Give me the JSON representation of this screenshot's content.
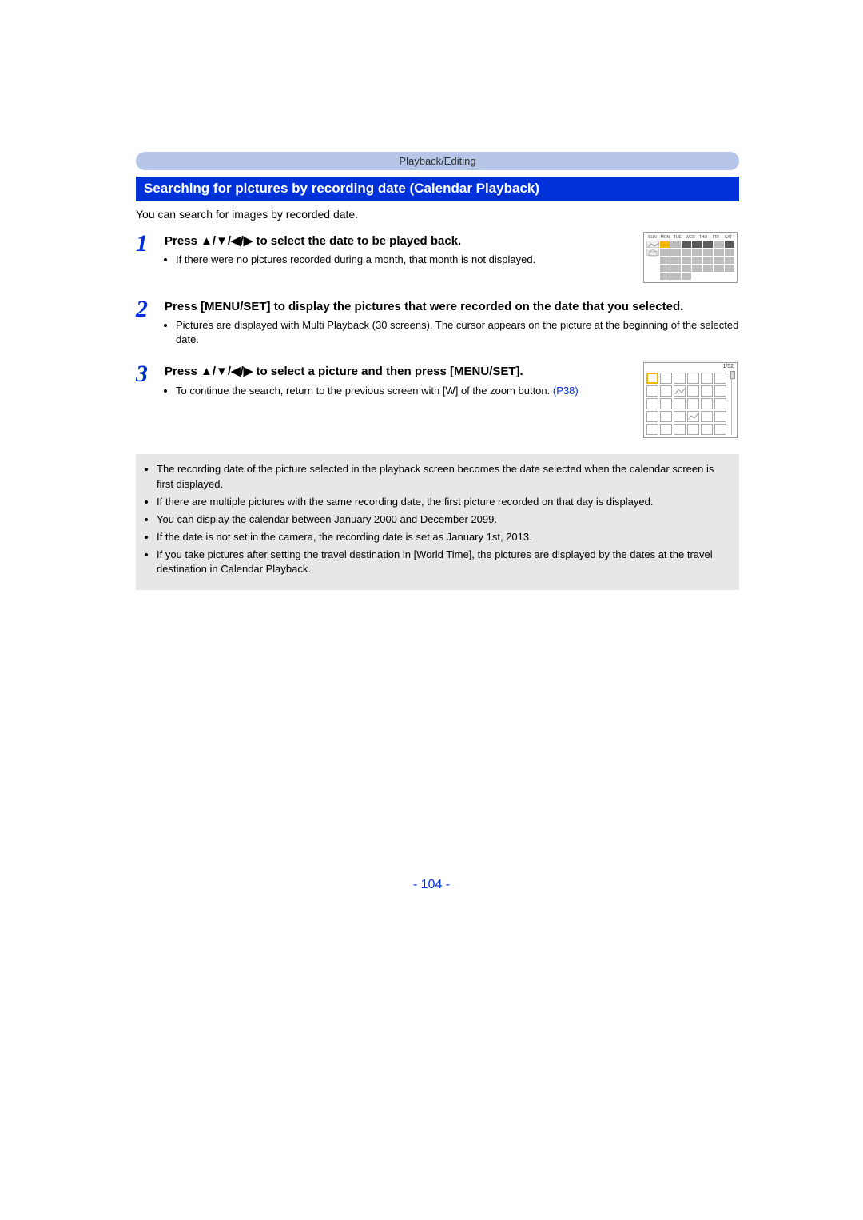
{
  "breadcrumb": "Playback/Editing",
  "title": "Searching for pictures by recording date (Calendar Playback)",
  "intro": "You can search for images by recorded date.",
  "steps": [
    {
      "num": "1",
      "heading": "Press ▲/▼/◀/▶ to select the date to be played back.",
      "bullets": [
        "If there were no pictures recorded during a month, that month is not displayed."
      ]
    },
    {
      "num": "2",
      "heading": "Press [MENU/SET] to display the pictures that were recorded on the date that you selected.",
      "bullets": [
        "Pictures are displayed with Multi Playback (30 screens). The cursor appears on the picture at the beginning of the selected date."
      ]
    },
    {
      "num": "3",
      "heading": "Press ▲/▼/◀/▶ to select a picture and then press [MENU/SET].",
      "bullets": [
        "To continue the search, return to the previous screen with [W] of the zoom button."
      ],
      "link_text": "(P38)"
    }
  ],
  "calendar_days": [
    "SUN",
    "MON",
    "TUE",
    "WED",
    "THU",
    "FRI",
    "SAT"
  ],
  "multi_counter": "1/52",
  "notes": [
    "The recording date of the picture selected in the playback screen becomes the date selected when the calendar screen is first displayed.",
    "If there are multiple pictures with the same recording date, the first picture recorded on that day is displayed.",
    "You can display the calendar between January 2000 and December 2099.",
    "If the date is not set in the camera, the recording date is set as January 1st, 2013.",
    "If you take pictures after setting the travel destination in [World Time], the pictures are displayed by the dates at the travel destination in Calendar Playback."
  ],
  "page_number": "- 104 -"
}
